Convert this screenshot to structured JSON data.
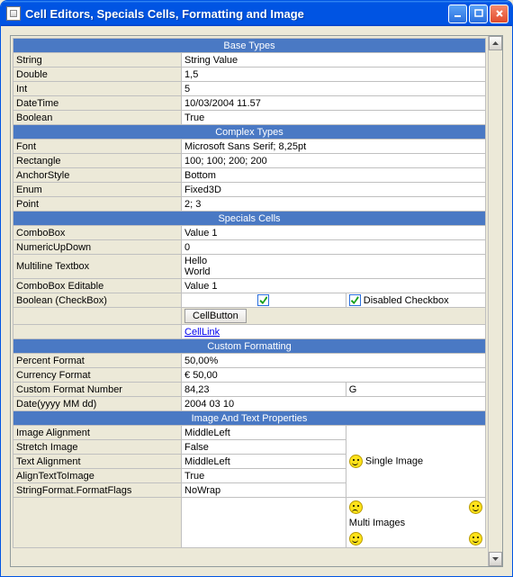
{
  "window": {
    "title": "Cell Editors, Specials Cells, Formatting and Image"
  },
  "sections": {
    "base": {
      "header": "Base Types",
      "rows": {
        "string": {
          "label": "String",
          "value": "String Value"
        },
        "double": {
          "label": "Double",
          "value": "1,5"
        },
        "int": {
          "label": "Int",
          "value": "5"
        },
        "datetime": {
          "label": "DateTime",
          "value": "10/03/2004 11.57"
        },
        "boolean": {
          "label": "Boolean",
          "value": "True"
        }
      }
    },
    "complex": {
      "header": "Complex Types",
      "rows": {
        "font": {
          "label": "Font",
          "value": "Microsoft Sans Serif; 8,25pt"
        },
        "rectangle": {
          "label": "Rectangle",
          "value": "100; 100; 200; 200"
        },
        "anchor": {
          "label": "AnchorStyle",
          "value": "Bottom"
        },
        "enum": {
          "label": "Enum",
          "value": "Fixed3D"
        },
        "point": {
          "label": "Point",
          "value": "2; 3"
        }
      }
    },
    "specials": {
      "header": "Specials Cells",
      "rows": {
        "combobox": {
          "label": "ComboBox",
          "value": "Value 1"
        },
        "numeric": {
          "label": "NumericUpDown",
          "value": "0"
        },
        "multiline": {
          "label": "Multiline Textbox",
          "value": "Hello\nWorld"
        },
        "comboeditable": {
          "label": "ComboBox Editable",
          "value": "Value 1"
        },
        "boolchk": {
          "label": "Boolean (CheckBox)",
          "disabled_label": "Disabled Checkbox"
        },
        "cellbutton": {
          "label": "CellButton"
        },
        "celllink": {
          "label": "CellLink"
        }
      }
    },
    "format": {
      "header": "Custom Formatting",
      "rows": {
        "percent": {
          "label": "Percent Format",
          "value": "50,00%"
        },
        "currency": {
          "label": "Currency Format",
          "value": "€ 50,00"
        },
        "custom": {
          "label": "Custom Format Number",
          "value": "84,23",
          "extra": "G"
        },
        "date": {
          "label": "Date(yyyy MM dd)",
          "value": "2004 03 10"
        }
      }
    },
    "image": {
      "header": "Image And Text Properties",
      "rows": {
        "align": {
          "label": "Image Alignment",
          "value": "MiddleLeft"
        },
        "stretch": {
          "label": "Stretch Image",
          "value": "False"
        },
        "textalign": {
          "label": "Text Alignment",
          "value": "MiddleLeft"
        },
        "aligntti": {
          "label": "AlignTextToImage",
          "value": "True"
        },
        "formatflags": {
          "label": "StringFormat.FormatFlags",
          "value": "NoWrap"
        }
      },
      "single_image_label": "Single Image",
      "multi_images_label": "Multi Images"
    }
  }
}
